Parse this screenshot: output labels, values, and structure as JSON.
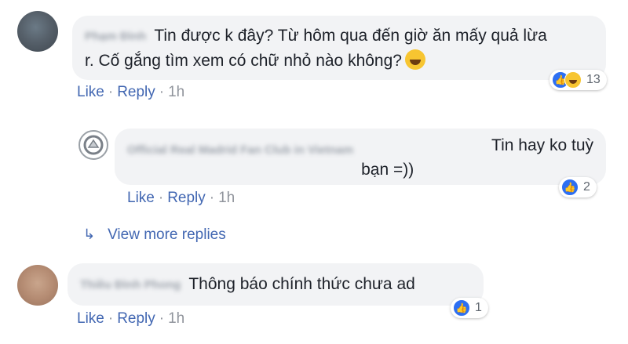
{
  "comments": [
    {
      "author": "Phạm Đình",
      "text_line1": "Tin được k đây? Từ hôm qua đến giờ ăn mấy quả lừa",
      "text_line2": "r. Cố gắng tìm xem có chữ nhỏ nào không?",
      "reaction_count": "13",
      "actions": {
        "like": "Like",
        "reply": "Reply",
        "sep": "·",
        "time": "1h"
      }
    },
    {
      "author": "Official Real Madrid Fan Club in Vietnam",
      "text_line1": "Tin hay ko tuỳ",
      "text_line2": "bạn =))",
      "reaction_count": "2",
      "actions": {
        "like": "Like",
        "reply": "Reply",
        "sep": "·",
        "time": "1h"
      }
    },
    {
      "author": "Thiều Đình Phong",
      "text": "Thông báo chính thức chưa ad",
      "reaction_count": "1",
      "actions": {
        "like": "Like",
        "reply": "Reply",
        "sep": "·",
        "time": "1h"
      }
    }
  ],
  "view_more": {
    "arrow": "↳",
    "label": "View more replies"
  },
  "colors": {
    "link": "#4267b2",
    "bubble": "#f2f3f5",
    "like_blue": "#2d6ff2",
    "haha_yellow": "#f7c531"
  },
  "icons": [
    "like-icon",
    "haha-icon",
    "laughing-emoji",
    "reply-arrow-icon"
  ]
}
